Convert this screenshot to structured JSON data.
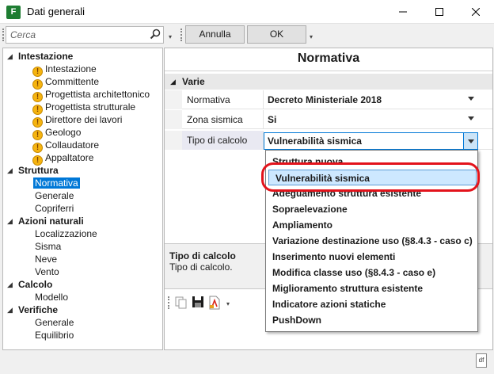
{
  "window": {
    "title": "Dati generali",
    "app_icon_text": "F"
  },
  "search": {
    "placeholder": "Cerca"
  },
  "toolbar": {
    "cancel_label": "Annulla",
    "ok_label": "OK"
  },
  "tree": [
    {
      "label": "Intestazione",
      "group": true,
      "expanded": true,
      "children": [
        {
          "label": "Intestazione",
          "warn": true
        },
        {
          "label": "Committente",
          "warn": true
        },
        {
          "label": "Progettista architettonico",
          "warn": true
        },
        {
          "label": "Progettista strutturale",
          "warn": true
        },
        {
          "label": "Direttore dei lavori",
          "warn": true
        },
        {
          "label": "Geologo",
          "warn": true
        },
        {
          "label": "Collaudatore",
          "warn": true
        },
        {
          "label": "Appaltatore",
          "warn": true
        }
      ]
    },
    {
      "label": "Struttura",
      "group": true,
      "expanded": true,
      "children": [
        {
          "label": "Normativa",
          "selected": true
        },
        {
          "label": "Generale"
        },
        {
          "label": "Copriferri"
        }
      ]
    },
    {
      "label": "Azioni naturali",
      "group": true,
      "expanded": true,
      "children": [
        {
          "label": "Localizzazione"
        },
        {
          "label": "Sisma"
        },
        {
          "label": "Neve"
        },
        {
          "label": "Vento"
        }
      ]
    },
    {
      "label": "Calcolo",
      "group": true,
      "expanded": true,
      "children": [
        {
          "label": "Modello"
        }
      ]
    },
    {
      "label": "Verifiche",
      "group": true,
      "expanded": true,
      "children": [
        {
          "label": "Generale"
        },
        {
          "label": "Equilibrio"
        }
      ]
    }
  ],
  "panel": {
    "title": "Normativa",
    "section": "Varie",
    "properties": [
      {
        "label": "Normativa",
        "value": "Decreto Ministeriale 2018"
      },
      {
        "label": "Zona sismica",
        "value": "Si"
      },
      {
        "label": "Tipo di calcolo",
        "value": "Vulnerabilità sismica"
      }
    ],
    "description_title": "Tipo di calcolo",
    "description_text": "Tipo di calcolo."
  },
  "dropdown": {
    "options": [
      "Struttura nuova",
      "Vulnerabilità sismica",
      "Adeguamento struttura esistente",
      "Sopraelevazione",
      "Ampliamento",
      "Variazione destinazione uso (§8.4.3 - caso c)",
      "Inserimento nuovi elementi",
      "Modifica classe uso (§8.4.3 - caso e)",
      "Miglioramento struttura esistente",
      "Indicatore azioni statiche",
      "PushDown"
    ],
    "highlighted_index": 1
  },
  "colors": {
    "accent": "#0078d7",
    "highlight_ring": "#e3131b",
    "warning": "#f6b40f"
  }
}
